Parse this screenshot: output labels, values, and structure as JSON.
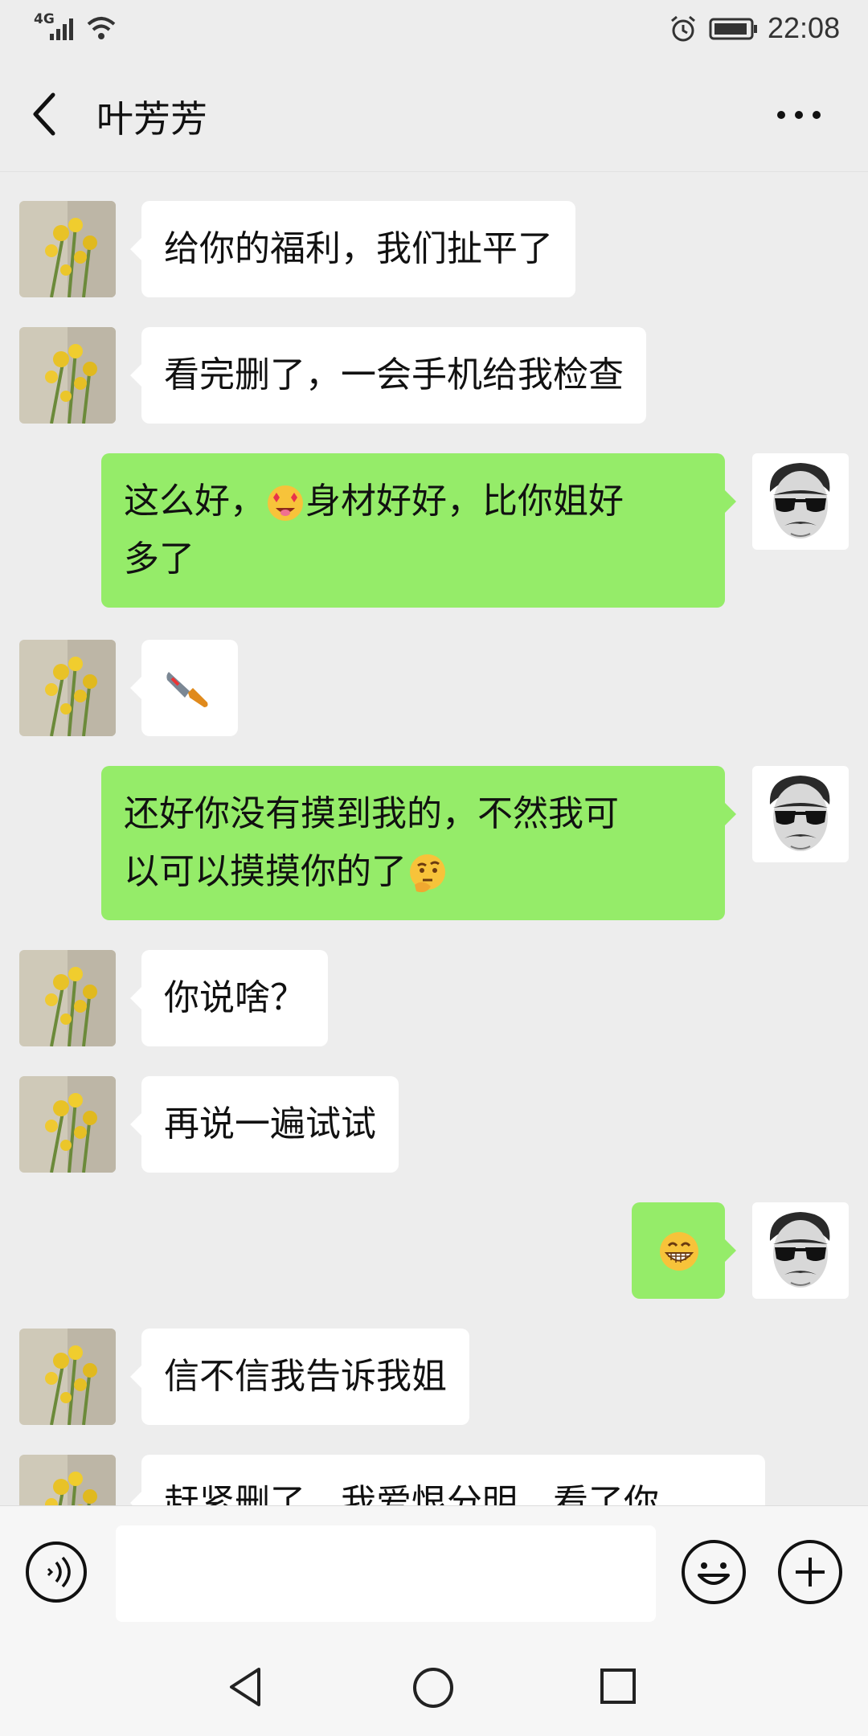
{
  "status_bar": {
    "network": "4G",
    "time": "22:08"
  },
  "header": {
    "title": "叶芳芳"
  },
  "messages": [
    {
      "side": "in",
      "text": "给你的福利，我们扯平了"
    },
    {
      "side": "in",
      "text": "看完删了，一会手机给我检查"
    },
    {
      "side": "out",
      "line1_a": "这么好，",
      "emoji": "star-struck-drooling-emoji",
      "line1_b": "身材好好，比你姐好",
      "line2": "多了"
    },
    {
      "side": "in",
      "emoji": "knife-emoji"
    },
    {
      "side": "out",
      "line1": "还好你没有摸到我的，不然我可",
      "line2": "以可以摸摸你的了",
      "emoji": "thinking-emoji"
    },
    {
      "side": "in",
      "text": "你说啥？"
    },
    {
      "side": "in",
      "text": "再说一遍试试"
    },
    {
      "side": "out",
      "emoji": "grinning-emoji"
    },
    {
      "side": "in",
      "text": "信不信我告诉我姐"
    },
    {
      "side": "in",
      "text": "赶紧删了，我爱恨分明，看了你"
    }
  ],
  "input_bar": {
    "voice_icon": "voice-icon",
    "emoji_icon": "emoji-icon",
    "plus_icon": "plus-icon",
    "input_value": ""
  },
  "colors": {
    "background": "#ededed",
    "incoming_bubble": "#ffffff",
    "outgoing_bubble": "#95ec69"
  }
}
